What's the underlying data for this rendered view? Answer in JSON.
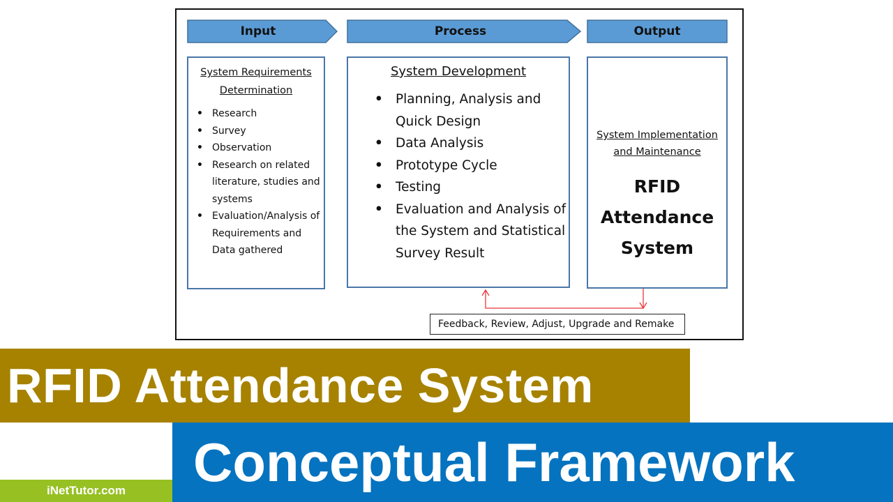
{
  "diagram": {
    "stages": [
      {
        "label": "Input"
      },
      {
        "label": "Process"
      },
      {
        "label": "Output"
      }
    ],
    "input": {
      "title": "System Requirements Determination",
      "items": [
        "Research",
        "Survey",
        "Observation",
        "Research on related literature, studies and systems",
        "Evaluation/Analysis of Requirements and Data gathered"
      ]
    },
    "process": {
      "title": "System Development",
      "items": [
        "Planning, Analysis and Quick Design",
        "Data Analysis",
        "Prototype Cycle",
        "Testing",
        "Evaluation and Analysis of the System and Statistical Survey Result"
      ]
    },
    "output": {
      "title": "System Implementation and Maintenance",
      "system_name": "RFID Attendance System"
    },
    "feedback": "Feedback, Review, Adjust, Upgrade and Remake"
  },
  "banner": {
    "title": "RFID Attendance System",
    "subtitle": "Conceptual Framework",
    "brand": "iNetTutor.com"
  },
  "colors": {
    "stage_fill": "#5b9bd5",
    "stage_border": "#41719c",
    "box_border": "#4a76a8",
    "feedback_arrow": "#e8383d",
    "title_banner": "#a68200",
    "subtitle_banner": "#0573bf",
    "brand_banner": "#97c023"
  }
}
